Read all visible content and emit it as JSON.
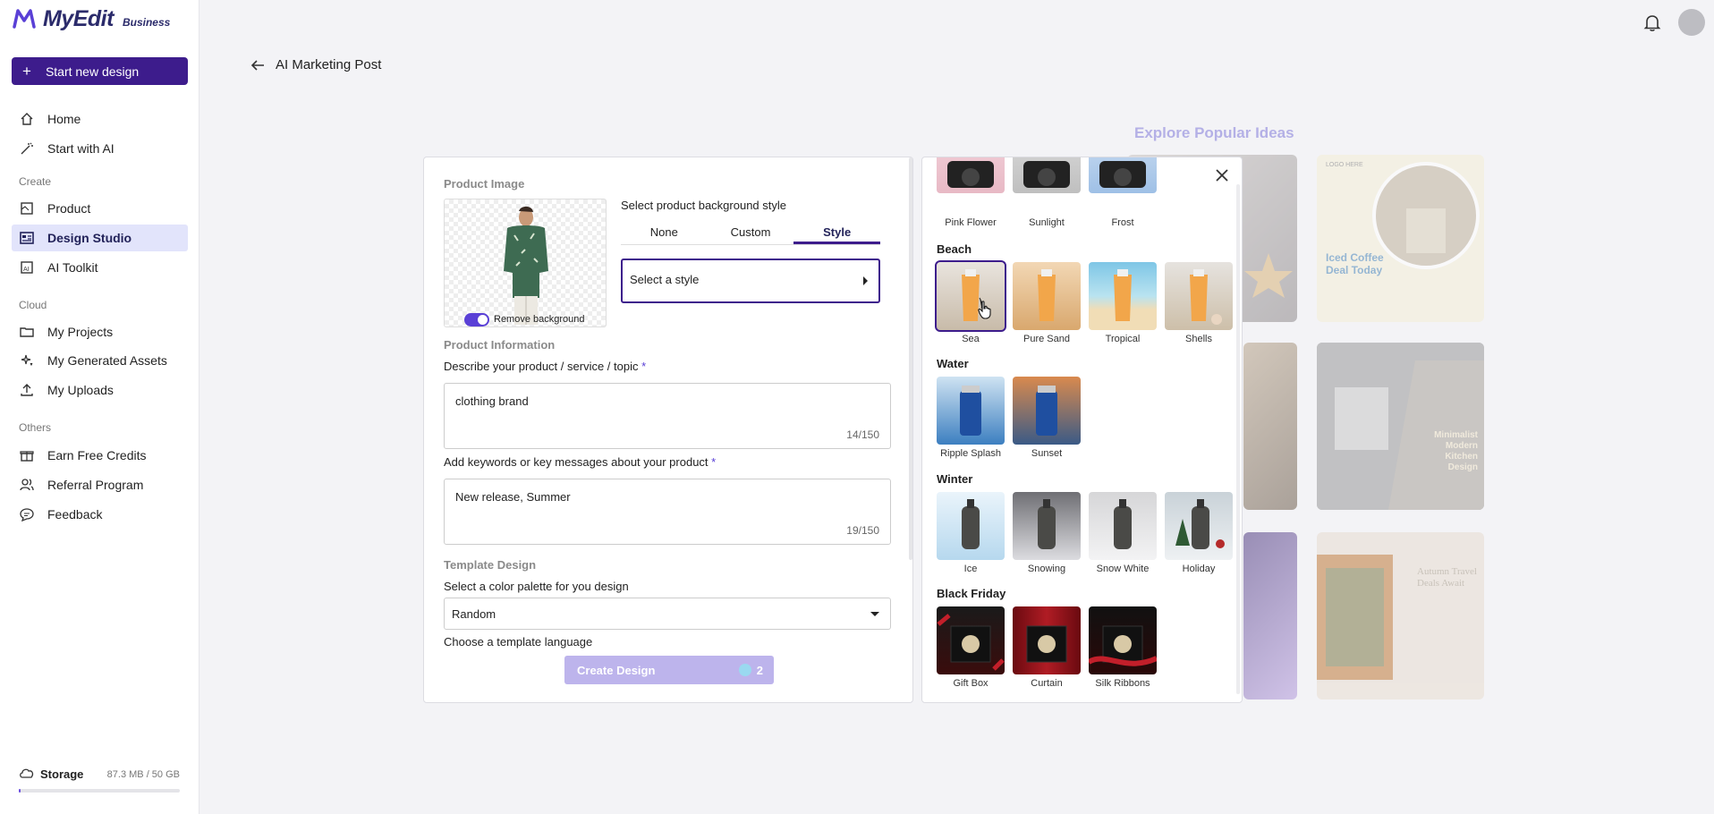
{
  "app": {
    "logo_text": "MyEdit",
    "logo_sub": "Business",
    "new_design_label": "Start new design"
  },
  "sidebar": {
    "top_items": [
      {
        "label": "Home",
        "icon": "home-icon"
      },
      {
        "label": "Start with AI",
        "icon": "magic-wand-icon"
      }
    ],
    "create_label": "Create",
    "create_items": [
      {
        "label": "Product",
        "icon": "product-icon"
      },
      {
        "label": "Design Studio",
        "icon": "design-studio-icon",
        "active": true
      },
      {
        "label": "AI Toolkit",
        "icon": "ai-toolkit-icon"
      }
    ],
    "cloud_label": "Cloud",
    "cloud_items": [
      {
        "label": "My Projects",
        "icon": "folder-icon"
      },
      {
        "label": "My Generated Assets",
        "icon": "sparkle-icon"
      },
      {
        "label": "My Uploads",
        "icon": "upload-icon"
      }
    ],
    "others_label": "Others",
    "others_items": [
      {
        "label": "Earn Free Credits",
        "icon": "gift-icon"
      },
      {
        "label": "Referral Program",
        "icon": "users-icon"
      },
      {
        "label": "Feedback",
        "icon": "chat-icon"
      }
    ],
    "storage_label": "Storage",
    "storage_value": "87.3 MB / 50 GB",
    "storage_fraction": 0.0017
  },
  "header": {
    "back_title": "AI Marketing Post",
    "explore_title": "Explore Popular Ideas"
  },
  "form": {
    "product_image_label": "Product Image",
    "remove_bg_label": "Remove background",
    "bg_style_label": "Select product background style",
    "tabs": [
      "None",
      "Custom",
      "Style"
    ],
    "active_tab": "Style",
    "select_style_placeholder": "Select a style",
    "product_info_label": "Product Information",
    "describe_label": "Describe your product / service / topic",
    "describe_value": "clothing brand",
    "describe_count": "14/150",
    "keywords_label": "Add keywords or key messages about your product",
    "keywords_value": "New release, Summer",
    "keywords_count": "19/150",
    "template_design_label": "Template Design",
    "palette_label": "Select a color palette for you design",
    "palette_value": "Random",
    "language_label": "Choose a template language",
    "create_label": "Create Design",
    "create_credits": "2",
    "required_mark": "*"
  },
  "style_panel": {
    "top_row": [
      "Pink Flower",
      "Sunlight",
      "Frost"
    ],
    "categories": [
      {
        "name": "Beach",
        "items": [
          "Sea",
          "Pure Sand",
          "Tropical",
          "Shells"
        ]
      },
      {
        "name": "Water",
        "items": [
          "Ripple Splash",
          "Sunset"
        ]
      },
      {
        "name": "Winter",
        "items": [
          "Ice",
          "Snowing",
          "Snow White",
          "Holiday"
        ]
      },
      {
        "name": "Black Friday",
        "items": [
          "Gift Box",
          "Curtain",
          "Silk Ribbons"
        ]
      }
    ],
    "selected": "Sea"
  },
  "idea_cards": {
    "coffee_title": "Iced Coffee Deal Today",
    "kitchen_title": "Minimalist Modern Kitchen Design",
    "travel_title": "Autumn Travel Deals Await",
    "logo_here": "LOGO HERE"
  },
  "colors": {
    "accent": "#3d1c8c",
    "active_nav": "#e2e4fb",
    "create_btn": "#bdb4ec"
  }
}
